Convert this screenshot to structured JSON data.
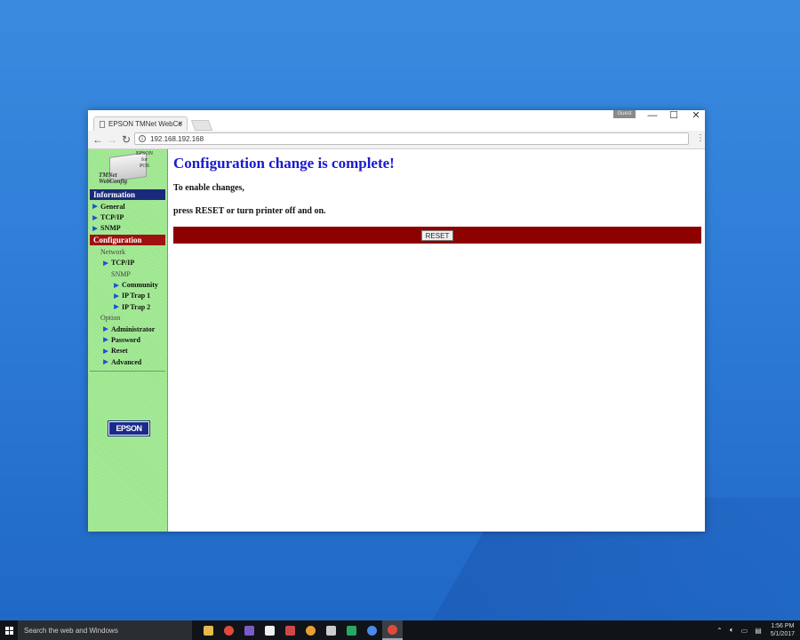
{
  "browser": {
    "tab_title": "EPSON TMNet WebConfig",
    "tab_close": "×",
    "guest_badge": "Guest",
    "url": "192.168.192.168",
    "controls": {
      "minimize": "—",
      "maximize": "☐",
      "close": "✕"
    }
  },
  "sidebar": {
    "logo_brand": "EPSON",
    "logo_for": "for",
    "logo_pos": "POS",
    "logo_product_line1": "TMNet",
    "logo_product_line2": "WebConfig",
    "information_header": "Information",
    "information_items": [
      {
        "label": "General"
      },
      {
        "label": "TCP/IP"
      },
      {
        "label": "SNMP"
      }
    ],
    "configuration_header": "Configuration",
    "network_label": "Network",
    "network_tcpip": "TCP/IP",
    "snmp_label": "SNMP",
    "snmp_items": [
      {
        "label": "Community"
      },
      {
        "label": "IP Trap 1"
      },
      {
        "label": "IP Trap 2"
      }
    ],
    "option_label": "Option",
    "option_items": [
      {
        "label": "Administrator"
      },
      {
        "label": "Password"
      },
      {
        "label": "Reset"
      },
      {
        "label": "Advanced"
      }
    ],
    "bottom_logo": "EPSON"
  },
  "main": {
    "heading": "Configuration change is complete!",
    "line1": "To enable changes,",
    "line2": "press RESET or turn printer off and on.",
    "reset_button": "RESET"
  },
  "taskbar": {
    "search_placeholder": "Search the web and Windows",
    "time": "1:56 PM",
    "date": "5/1/2017",
    "apps": [
      {
        "icon": "file-explorer-icon",
        "color": "#e8b84a"
      },
      {
        "icon": "chrome-icon",
        "color": "#e04a3a"
      },
      {
        "icon": "visual-studio-icon",
        "color": "#7a5cc8"
      },
      {
        "icon": "app-icon",
        "color": "#f0f0f0"
      },
      {
        "icon": "paint-icon",
        "color": "#d04848"
      },
      {
        "icon": "chrome-canary-icon",
        "color": "#e8a030"
      },
      {
        "icon": "calculator-icon",
        "color": "#cccccc"
      },
      {
        "icon": "grammarly-icon",
        "color": "#28a860"
      },
      {
        "icon": "chrome-app-icon",
        "color": "#4a8ae8"
      },
      {
        "icon": "chrome-active-icon",
        "color": "#e04a3a"
      }
    ]
  },
  "colors": {
    "sidebar_bg": "#9be68c",
    "info_header": "#1a2a7a",
    "config_header": "#a01010",
    "heading": "#1a1ad0",
    "reset_bar": "#8c0000"
  }
}
